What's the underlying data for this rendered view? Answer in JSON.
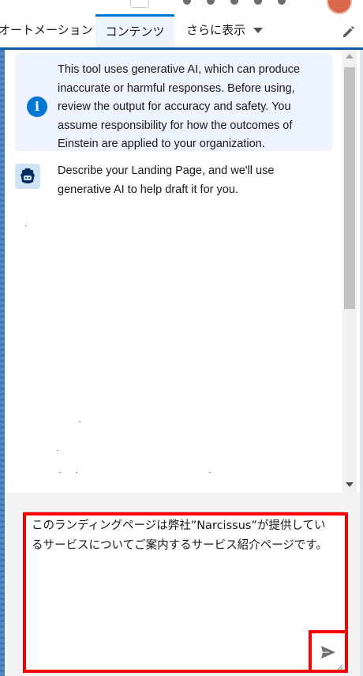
{
  "tabs": [
    {
      "label": "オートメーション",
      "active": false
    },
    {
      "label": "コンテンツ",
      "active": true
    },
    {
      "label": "さらに表示",
      "active": false,
      "dropdown": true
    }
  ],
  "icons": {
    "edit": "pencil-icon",
    "info": "info-icon",
    "bot": "einstein-bot-icon",
    "send": "send-icon",
    "more": "chevron-down-icon"
  },
  "chat": {
    "notice": {
      "lines": [
        "This tool uses generative AI, which can produce",
        "inaccurate or harmful responses. Before using,",
        "review the output for accuracy and safety. You",
        "assume responsibility for how the outcomes of",
        "Einstein are applied to your organization."
      ]
    },
    "bot_message": {
      "lines": [
        "Describe your Landing Page, and we'll use",
        "generative AI to help draft it for you."
      ]
    }
  },
  "prompt_input": {
    "value_lines": [
      "このランディングページは弊社”Narcissus”が提供してい",
      "るサービスについてご案内するサービス紹介ページです。"
    ]
  },
  "colors": {
    "brand": "#0176d3",
    "tab_underline": "#0b5cab",
    "highlight": "#ff0000",
    "notice_bg": "#eef4ff"
  }
}
